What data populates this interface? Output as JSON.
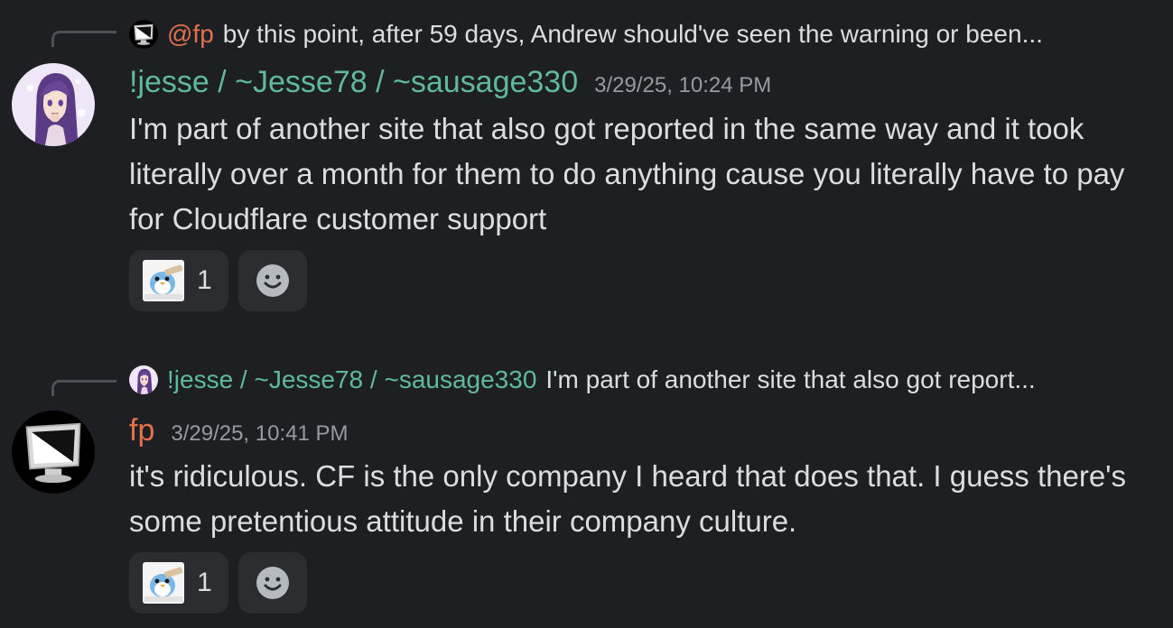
{
  "colors": {
    "background": "#1e1f22",
    "pill_background": "#2b2d31",
    "jesse_name": "#5fba9b",
    "fp_name": "#e0714c",
    "text": "#dbdee1",
    "muted": "#949ba4"
  },
  "messages": [
    {
      "reply": {
        "avatar_icon": "monitor-icon",
        "author": "@fp",
        "text": "by this point, after 59 days, Andrew should've seen the warning or been..."
      },
      "avatar_icon": "anime-girl-avatar",
      "author": "!jesse / ~Jesse78 / ~sausage330",
      "timestamp": "3/29/25, 10:24 PM",
      "body": "I'm part of another site that also got reported in the same way and it took literally over a month for them to do anything cause you literally have to pay for Cloudflare customer support",
      "reaction": {
        "emoji": "penguin-emoji",
        "count": "1"
      },
      "add_reaction_icon": "smiley-add-reaction-icon"
    },
    {
      "reply": {
        "avatar_icon": "anime-girl-avatar",
        "author": "!jesse / ~Jesse78 / ~sausage330",
        "text": "I'm part of another site that also got report..."
      },
      "avatar_icon": "monitor-icon",
      "author": "fp",
      "timestamp": "3/29/25, 10:41 PM",
      "body": "it's ridiculous. CF is the only company I heard that does that. I guess there's some pretentious attitude in their company culture.",
      "reaction": {
        "emoji": "penguin-emoji",
        "count": "1"
      },
      "add_reaction_icon": "smiley-add-reaction-icon"
    }
  ]
}
